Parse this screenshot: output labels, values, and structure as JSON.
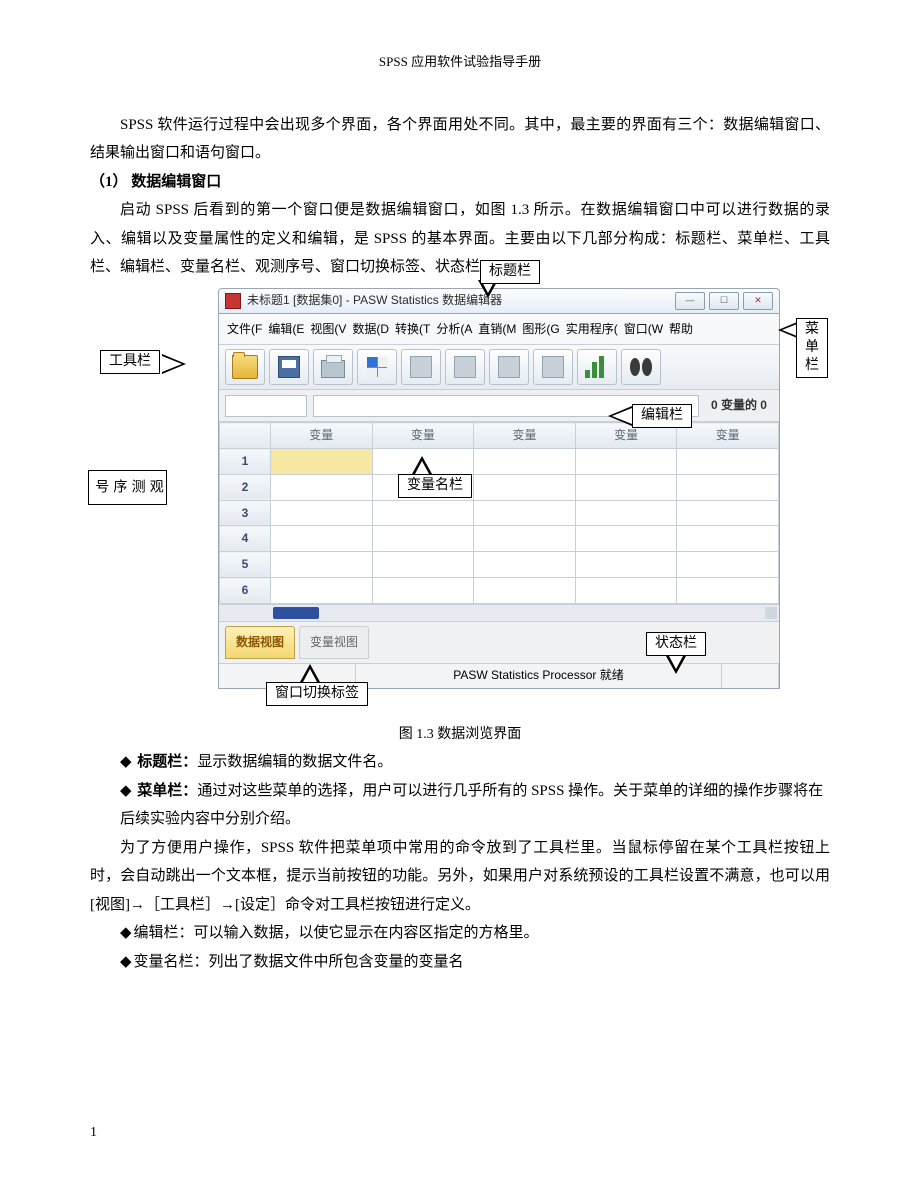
{
  "doc": {
    "header_title": "SPSS 应用软件试验指导手册",
    "page_number": "1",
    "intro_p": "SPSS 软件运行过程中会出现多个界面，各个界面用处不同。其中，最主要的界面有三个：数据编辑窗口、结果输出窗口和语句窗口。",
    "section1_title": "（1） 数据编辑窗口",
    "section1_p": "启动 SPSS 后看到的第一个窗口便是数据编辑窗口，如图 1.3 所示。在数据编辑窗口中可以进行数据的录入、编辑以及变量属性的定义和编辑，是 SPSS 的基本界面。主要由以下几部分构成：标题栏、菜单栏、工具栏、编辑栏、变量名栏、观测序号、窗口切换标签、状态栏。",
    "caption": "图 1.3  数据浏览界面",
    "bullet_title_strong": "标题栏：",
    "bullet_title_rest": "显示数据编辑的数据文件名。",
    "bullet_menu_strong": "菜单栏：",
    "bullet_menu_rest": "通过对这些菜单的选择，用户可以进行几乎所有的 SPSS 操作。关于菜单的详细的操作步骤将在后续实验内容中分别介绍。",
    "tool_p": "为了方便用户操作，SPSS 软件把菜单项中常用的命令放到了工具栏里。当鼠标停留在某个工具栏按钮上时，会自动跳出一个文本框，提示当前按钮的功能。另外，如果用户对系统预设的工具栏设置不满意，也可以用[视图]→［工具栏］→[设定］命令对工具栏按钮进行定义。",
    "bullet_edit": "编辑栏：可以输入数据，以使它显示在内容区指定的方格里。",
    "bullet_varname": "变量名栏：列出了数据文件中所包含变量的变量名"
  },
  "labels": {
    "title_bar": "标题栏",
    "menu_bar": "菜单栏",
    "tool_bar": "工具栏",
    "edit_bar": "编辑栏",
    "varname_bar": "变量名栏",
    "row_num": "观测序号",
    "status_bar": "状态栏",
    "view_tabs": "窗口切换标签"
  },
  "spss": {
    "window_title": "未标题1 [数据集0] - PASW Statistics 数据编辑器",
    "menus": [
      "文件(F",
      "编辑(E",
      "视图(V",
      "数据(D",
      "转换(T",
      "分析(A",
      "直销(M",
      "图形(G",
      "实用程序(",
      "窗口(W",
      "帮助"
    ],
    "var_header": "变量",
    "var_columns": [
      "变量",
      "变量",
      "变量",
      "变量",
      "变量"
    ],
    "row_nums": [
      "1",
      "2",
      "3",
      "4",
      "5",
      "6"
    ],
    "var_info": "0 变量的 0",
    "tab_data": "数据视图",
    "tab_var": "变量视图",
    "status_text": "PASW Statistics Processor 就绪"
  }
}
